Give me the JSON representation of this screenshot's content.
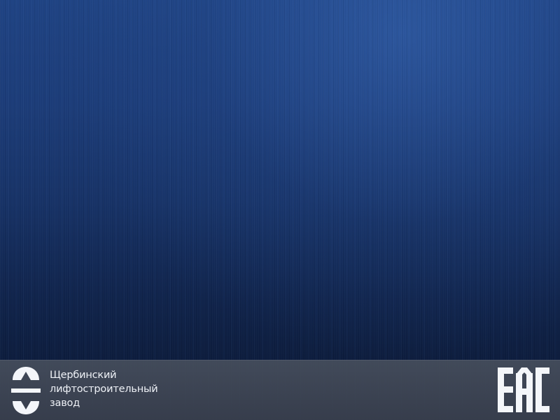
{
  "footer": {
    "company_name_lines": [
      "Щербинский",
      "лифтостроительный",
      "завод"
    ],
    "logo_icon": "shcherbinka-elevator-plant-logo-icon",
    "certification_mark": "EAC",
    "certification_icon": "eac-mark-icon"
  },
  "colors": {
    "background_top": "#1f4383",
    "background_bottom": "#0a1630",
    "footer_bar": "#3e4554",
    "text": "#eef1f6"
  }
}
